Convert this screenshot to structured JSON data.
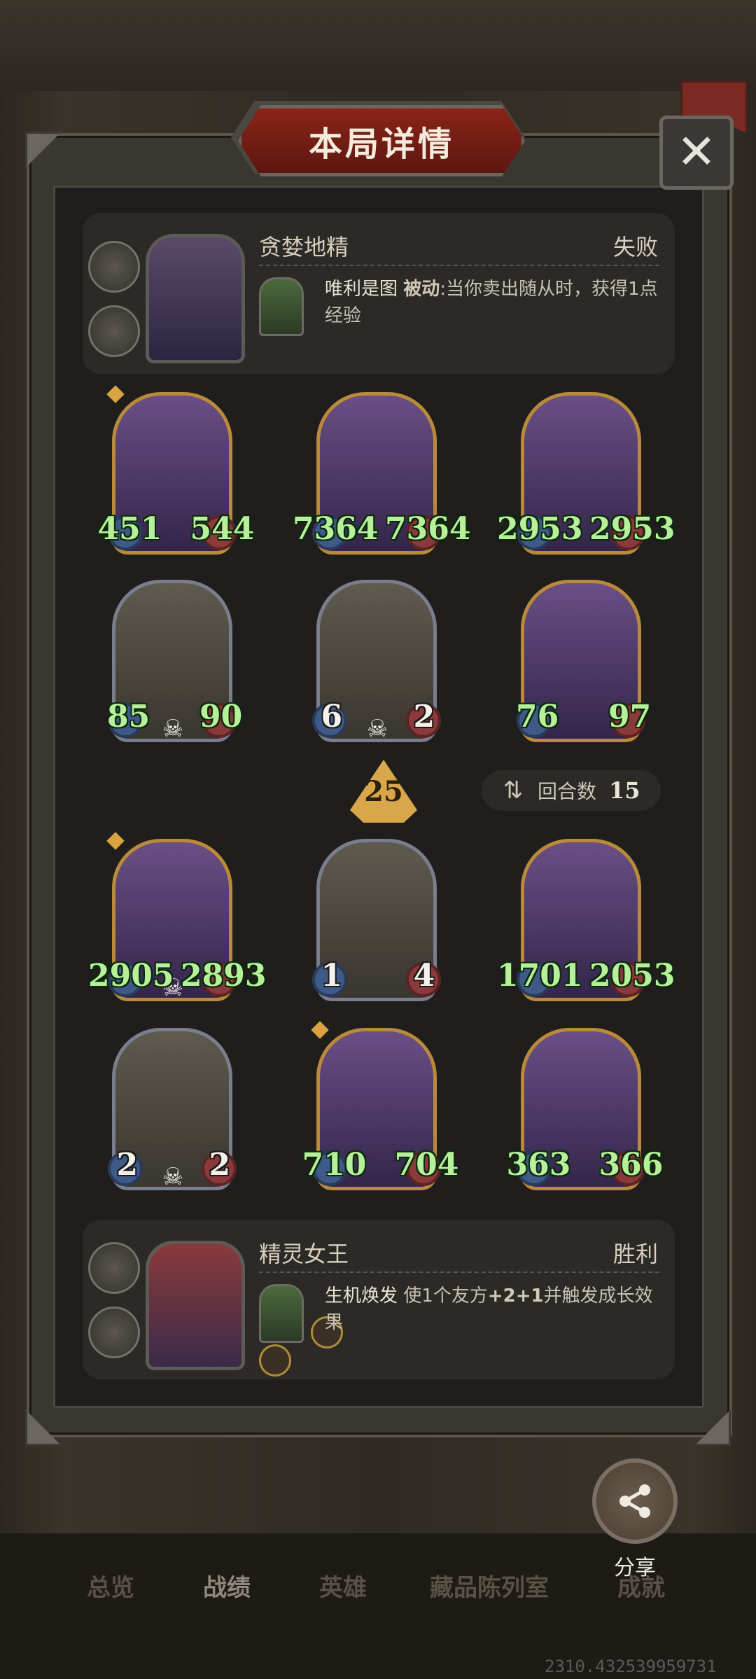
{
  "dialog": {
    "title": "本局详情",
    "close_icon": "close-icon"
  },
  "player_top": {
    "name": "贪婪地精",
    "result": "失败",
    "skill_name": "唯利是图",
    "skill_type": "被动",
    "skill_text": ":当你卖出随从时，获得1点经验"
  },
  "player_bottom": {
    "name": "精灵女王",
    "result": "胜利",
    "skill_name": "生机焕发",
    "skill_text_prefix": " 使1个友方",
    "skill_bonus": "+2+1",
    "skill_text_suffix": "并触发成长效果"
  },
  "top_minions": [
    {
      "attack": "451",
      "health": "544"
    },
    {
      "attack": "7364",
      "health": "7364"
    },
    {
      "attack": "2953",
      "health": "2953"
    },
    {
      "attack": "85",
      "health": "90"
    },
    {
      "attack": "6",
      "health": "2"
    },
    {
      "attack": "76",
      "health": "97"
    }
  ],
  "bottom_minions": [
    {
      "attack": "2905",
      "health": "2893"
    },
    {
      "attack": "1",
      "health": "4"
    },
    {
      "attack": "1701",
      "health": "2053"
    },
    {
      "attack": "2",
      "health": "2"
    },
    {
      "attack": "710",
      "health": "704"
    },
    {
      "attack": "363",
      "health": "366"
    }
  ],
  "tier": "25",
  "rounds": {
    "label": "回合数",
    "value": "15"
  },
  "nav": [
    "总览",
    "战绩",
    "英雄",
    "藏品陈列室",
    "成就"
  ],
  "share_label": "分享",
  "coord_text": "2310.432539959731"
}
